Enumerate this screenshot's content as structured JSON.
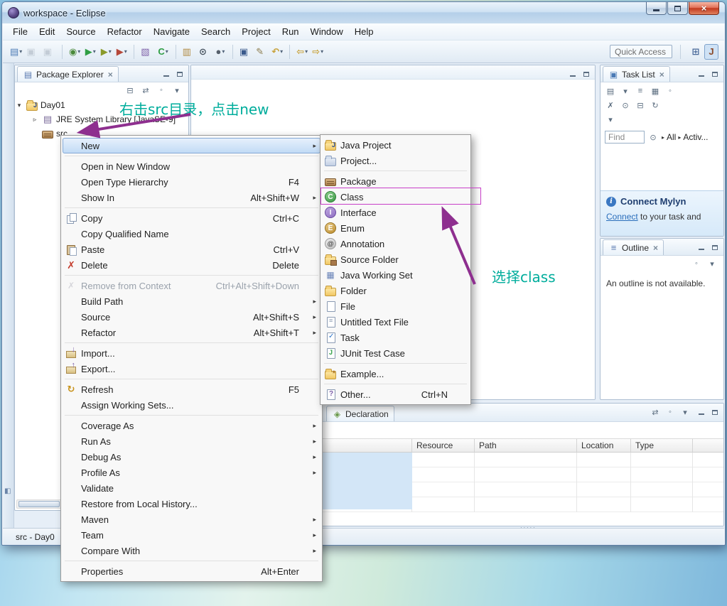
{
  "window": {
    "title": "workspace - Eclipse"
  },
  "menubar": {
    "items": [
      "File",
      "Edit",
      "Source",
      "Refactor",
      "Navigate",
      "Search",
      "Project",
      "Run",
      "Window",
      "Help"
    ]
  },
  "toolbar": {
    "quick_access": "Quick Access",
    "buttons": [
      {
        "name": "new-button",
        "glyph": "▤",
        "fg": "#4a7ab5",
        "caret": true
      },
      {
        "name": "save-button",
        "glyph": "▣",
        "fg": "#8a96a4",
        "disabled": true
      },
      {
        "name": "save-all-button",
        "glyph": "▣",
        "fg": "#8a96a4",
        "disabled": true
      },
      {
        "sep": true
      },
      {
        "name": "debug-button",
        "glyph": "◉",
        "fg": "#4a8a3a",
        "caret": true
      },
      {
        "name": "run-button",
        "glyph": "▶",
        "fg": "#2f9e44",
        "caret": true
      },
      {
        "name": "coverage-button",
        "glyph": "▶",
        "fg": "#8a9a2a",
        "caret": true
      },
      {
        "name": "run-external-button",
        "glyph": "▶",
        "fg": "#b5483a",
        "caret": true
      },
      {
        "sep": true
      },
      {
        "name": "new-java-project-button",
        "glyph": "▧",
        "fg": "#7d5fa8"
      },
      {
        "name": "new-class-button",
        "glyph": "C",
        "fg": "#2f9e44",
        "caret": true
      },
      {
        "sep": true
      },
      {
        "name": "open-jar-button",
        "glyph": "▥",
        "fg": "#b08a42"
      },
      {
        "name": "search-button",
        "glyph": "⊙",
        "fg": "#44505c"
      },
      {
        "name": "activate-task-button",
        "glyph": "●",
        "fg": "#56606c",
        "caret": true
      },
      {
        "sep": true
      },
      {
        "name": "console-button",
        "glyph": "▣",
        "fg": "#3a5a8c"
      },
      {
        "name": "annotation-nav-button",
        "glyph": "✎",
        "fg": "#8a7a4a"
      },
      {
        "name": "last-edit-location-button",
        "glyph": "↶",
        "fg": "#c8a23a",
        "caret": true
      },
      {
        "sep": true
      },
      {
        "name": "back-button",
        "glyph": "⇦",
        "fg": "#c8a23a",
        "caret": true
      },
      {
        "name": "forward-button",
        "glyph": "⇨",
        "fg": "#c8a23a",
        "caret": true
      }
    ],
    "right_buttons": [
      {
        "name": "open-perspective-button",
        "glyph": "⊞",
        "fg": "#4a6a9a"
      },
      {
        "name": "java-perspective-button",
        "glyph": "J",
        "fg": "#8a4a2a",
        "active": true
      }
    ]
  },
  "package_explorer": {
    "tab": "Package Explorer",
    "toolbar_icons": [
      "collapse-all",
      "link-with-editor",
      "overflow",
      "view-menu"
    ],
    "tree": [
      {
        "label": "Day01",
        "icon": "java-project",
        "twistie": "▾",
        "indent": 0
      },
      {
        "label": "JRE System Library [JavaSE-9]",
        "icon": "library",
        "twistie": "▹",
        "indent": 1
      },
      {
        "label": "src",
        "icon": "package",
        "twistie": "",
        "indent": 1
      }
    ]
  },
  "task_list": {
    "tab": "Task List",
    "toolbar_row1": [
      "new-task",
      "menu-caret",
      "categorized-presentation",
      "scheduled-presentation",
      "overflow"
    ],
    "toolbar_row2": [
      "delete-task",
      "search-tasks",
      "collapse-tasks",
      "synchronize"
    ],
    "toolbar_row3": [
      "view-menu"
    ],
    "find": "Find",
    "filter_all": "All",
    "filter_activated": "Activ..."
  },
  "mylyn": {
    "title": "Connect Mylyn",
    "link": "Connect",
    "rest": "to your task and "
  },
  "outline": {
    "tab": "Outline",
    "toolbar_icons": [
      "overflow",
      "view-menu"
    ],
    "message": "An outline is not available."
  },
  "declaration": {
    "tab": "Declaration",
    "toolbar_icons": [
      "link-with-editor",
      "overflow",
      "view-menu"
    ],
    "columns": [
      "",
      "Resource",
      "Path",
      "Location",
      "Type"
    ]
  },
  "statusbar": {
    "text": "src - Day0"
  },
  "context_menu": {
    "items": [
      {
        "label": "New",
        "submenu": true,
        "highlight": true
      },
      {
        "sep": true
      },
      {
        "label": "Open in New Window"
      },
      {
        "label": "Open Type Hierarchy",
        "shortcut": "F4"
      },
      {
        "label": "Show In",
        "shortcut": "Alt+Shift+W",
        "submenu": true
      },
      {
        "sep": true
      },
      {
        "label": "Copy",
        "shortcut": "Ctrl+C",
        "icon": "copy"
      },
      {
        "label": "Copy Qualified Name"
      },
      {
        "label": "Paste",
        "shortcut": "Ctrl+V",
        "icon": "paste"
      },
      {
        "label": "Delete",
        "shortcut": "Delete",
        "icon": "delete"
      },
      {
        "sep": true
      },
      {
        "label": "Remove from Context",
        "shortcut": "Ctrl+Alt+Shift+Down",
        "icon": "remove-context",
        "disabled": true
      },
      {
        "label": "Build Path",
        "submenu": true
      },
      {
        "label": "Source",
        "shortcut": "Alt+Shift+S",
        "submenu": true
      },
      {
        "label": "Refactor",
        "shortcut": "Alt+Shift+T",
        "submenu": true
      },
      {
        "sep": true
      },
      {
        "label": "Import...",
        "icon": "import"
      },
      {
        "label": "Export...",
        "icon": "export"
      },
      {
        "sep": true
      },
      {
        "label": "Refresh",
        "shortcut": "F5",
        "icon": "refresh"
      },
      {
        "label": "Assign Working Sets..."
      },
      {
        "sep": true
      },
      {
        "label": "Coverage As",
        "submenu": true
      },
      {
        "label": "Run As",
        "submenu": true
      },
      {
        "label": "Debug As",
        "submenu": true
      },
      {
        "label": "Profile As",
        "submenu": true
      },
      {
        "label": "Validate"
      },
      {
        "label": "Restore from Local History..."
      },
      {
        "label": "Maven",
        "submenu": true
      },
      {
        "label": "Team",
        "submenu": true
      },
      {
        "label": "Compare With",
        "submenu": true
      },
      {
        "sep": true
      },
      {
        "label": "Properties",
        "shortcut": "Alt+Enter"
      }
    ]
  },
  "new_submenu": {
    "items": [
      {
        "label": "Java Project",
        "icon": "java-project"
      },
      {
        "label": "Project...",
        "icon": "project"
      },
      {
        "sep": true
      },
      {
        "label": "Package",
        "icon": "package"
      },
      {
        "label": "Class",
        "icon": "class"
      },
      {
        "label": "Interface",
        "icon": "interface"
      },
      {
        "label": "Enum",
        "icon": "enum"
      },
      {
        "label": "Annotation",
        "icon": "annotation"
      },
      {
        "label": "Source Folder",
        "icon": "source-folder"
      },
      {
        "label": "Java Working Set",
        "icon": "working-set"
      },
      {
        "label": "Folder",
        "icon": "folder"
      },
      {
        "label": "File",
        "icon": "file"
      },
      {
        "label": "Untitled Text File",
        "icon": "text-file"
      },
      {
        "label": "Task",
        "icon": "task"
      },
      {
        "label": "JUnit Test Case",
        "icon": "junit"
      },
      {
        "sep": true
      },
      {
        "label": "Example...",
        "icon": "example"
      },
      {
        "sep": true
      },
      {
        "label": "Other...",
        "shortcut": "Ctrl+N",
        "icon": "other"
      }
    ]
  },
  "annotations": {
    "top": "右击src目录，点击new",
    "bottom": "选择class",
    "text_color": "#00ad9c",
    "arrow_color": "#8e2f8f",
    "box_color": "#c83fc8"
  },
  "icons": {
    "collapse-all": "⊟",
    "link-with-editor": "⇄",
    "overflow": "◦",
    "view-menu": "▾",
    "menu-caret": "▾",
    "new-task": "▤",
    "categorized-presentation": "≡",
    "scheduled-presentation": "▦",
    "delete-task": "✗",
    "search-tasks": "⊙",
    "collapse-tasks": "⊟",
    "synchronize": "↻"
  }
}
